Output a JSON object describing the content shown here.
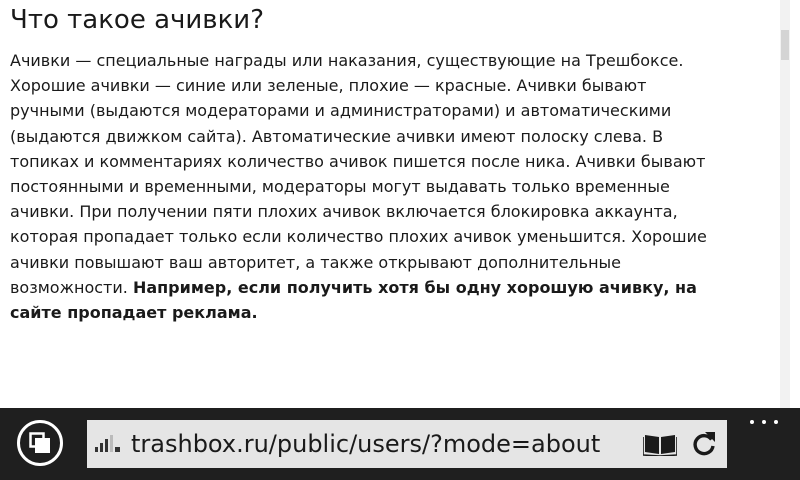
{
  "article": {
    "title": "Что такое ачивки?",
    "lines": [
      "Ачивки — специальные награды или наказания, существующие на Трешбоксе.",
      "Хорошие ачивки — синие или зеленые, плохие — красные. Ачивки бывают",
      "ручными (выдаются модераторами и администраторами) и автоматическими",
      "(выдаются движком сайта). Автоматические ачивки имеют полоску слева. В",
      "топиках и комментариях количество ачивок пишется после ника. Ачивки бывают",
      "постоянными и временными, модераторы могут выдавать только временные",
      "ачивки. При получении пяти плохих ачивок включается блокировка аккаунта,",
      "которая пропадает только если количество плохих ачивок уменьшится. Хорошие",
      "ачивки повышают ваш авторитет, а также открывают дополнительные"
    ],
    "last_line_normal": "возможности. ",
    "last_line_bold": "Например, если получить хотя бы одну хорошую ачивку, на",
    "bold_line": "сайте пропадает реклама."
  },
  "address_bar": {
    "url": "trashbox.ru/public/users/?mode=about"
  },
  "icons": {
    "tabs": "tabs-icon",
    "signal": "signal-icon",
    "reader": "reading-view-icon",
    "refresh": "refresh-icon",
    "more": "more-icon"
  },
  "colors": {
    "app_bar": "#1f1f1f",
    "address_box": "#e5e5e5",
    "text": "#1a1a1a"
  }
}
